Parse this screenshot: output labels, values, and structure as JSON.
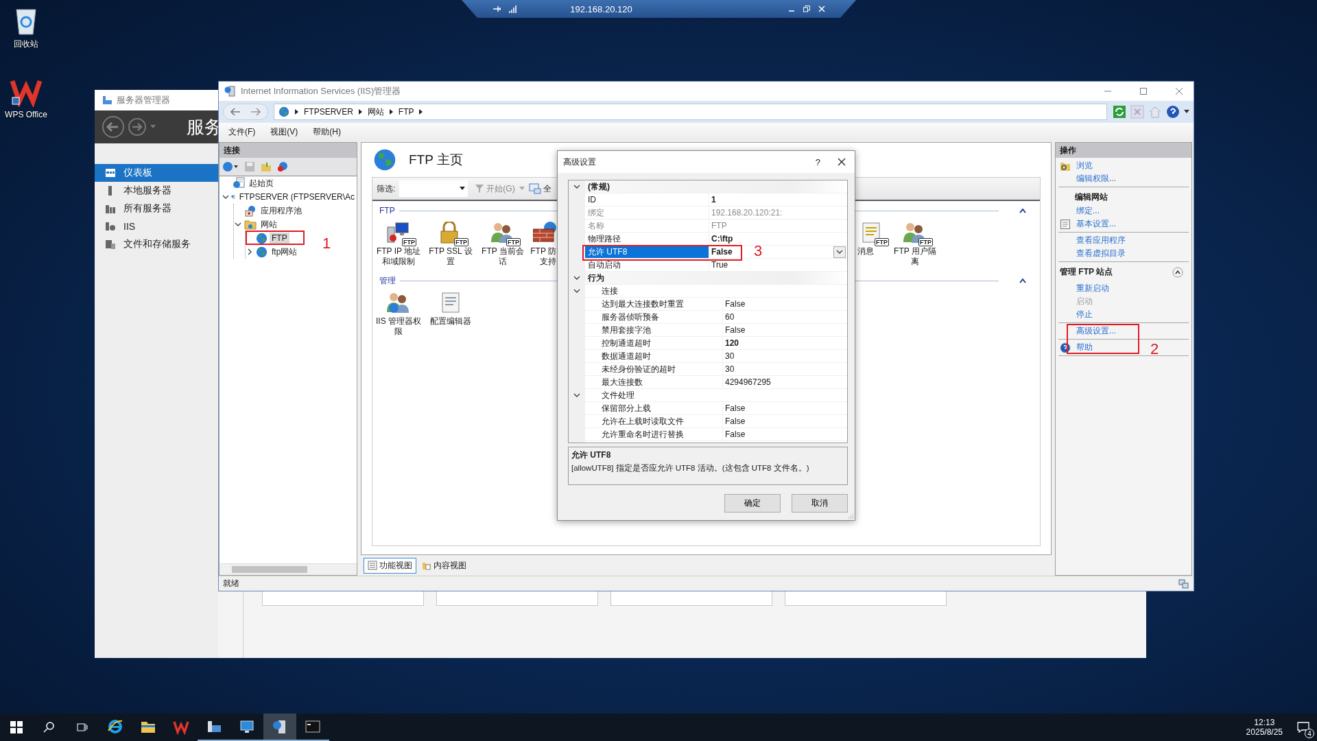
{
  "remote_bar": {
    "address": "192.168.20.120"
  },
  "desktop_icons": [
    {
      "label": "回收站",
      "kind": "recycle"
    },
    {
      "label": "WPS Office",
      "kind": "wps"
    }
  ],
  "server_manager": {
    "title": "服务器管理器",
    "header": "服务",
    "nav": [
      {
        "label": "仪表板",
        "kind": "dashboard",
        "selected": true
      },
      {
        "label": "本地服务器",
        "kind": "server",
        "selected": false
      },
      {
        "label": "所有服务器",
        "kind": "servers",
        "selected": false
      },
      {
        "label": "IIS",
        "kind": "iis",
        "selected": false
      },
      {
        "label": "文件和存储服务",
        "kind": "files",
        "selected": false
      }
    ]
  },
  "iis": {
    "title": "Internet Information Services (IIS)管理器",
    "breadcrumb": [
      "FTPSERVER",
      "网站",
      "FTP"
    ],
    "menu": [
      "文件(F)",
      "视图(V)",
      "帮助(H)"
    ],
    "connections": {
      "title": "连接",
      "tree": [
        {
          "label": "起始页",
          "kind": "start",
          "selected": false
        },
        {
          "label": "FTPSERVER (FTPSERVER\\Ac",
          "kind": "server",
          "selected": false,
          "expanded": true,
          "children": [
            {
              "label": "应用程序池",
              "kind": "pool",
              "selected": false
            },
            {
              "label": "网站",
              "kind": "folder",
              "selected": false,
              "expanded": true,
              "children": [
                {
                  "label": "FTP",
                  "kind": "site",
                  "selected": true
                },
                {
                  "label": "ftp网站",
                  "kind": "site",
                  "selected": false,
                  "expanded": false
                }
              ]
            }
          ]
        }
      ]
    },
    "home": {
      "title": "FTP 主页",
      "filter_label": "筛选:",
      "go_label": "开始(G)",
      "show_all_label": "全",
      "groups": [
        {
          "label": "FTP",
          "expanded": true,
          "features": [
            {
              "label": "FTP IP 地址和域限制",
              "kind": "ip",
              "badge": "FTP"
            },
            {
              "label": "FTP SSL 设置",
              "kind": "ssl",
              "badge": "FTP"
            },
            {
              "label": "FTP 当前会话",
              "kind": "sessions",
              "badge": "FTP"
            },
            {
              "label": "FTP 防",
              "label_cont": "支持",
              "kind": "firewall"
            },
            {
              "label": "消息",
              "kind": "messages",
              "badge": "FTP"
            },
            {
              "label": "FTP 用户隔离",
              "kind": "isolation",
              "badge": "FTP"
            }
          ]
        },
        {
          "label": "管理",
          "expanded": true,
          "features": [
            {
              "label": "IIS 管理器权限",
              "kind": "permissions"
            },
            {
              "label": "配置编辑器",
              "kind": "config"
            }
          ]
        }
      ]
    },
    "view_tabs": [
      {
        "label": "功能视图",
        "kind": "features",
        "selected": true
      },
      {
        "label": "内容视图",
        "kind": "content",
        "selected": false
      }
    ],
    "actions": {
      "title": "操作",
      "groups": [
        {
          "items": [
            {
              "label": "浏览",
              "kind": "browse",
              "disabled": false
            },
            {
              "label": "编辑权限...",
              "kind": "link",
              "disabled": false
            }
          ]
        },
        {
          "title": "编辑网站",
          "items": [
            {
              "label": "绑定...",
              "kind": "link",
              "disabled": false
            },
            {
              "label": "基本设置...",
              "kind": "settings",
              "disabled": false
            }
          ]
        },
        {
          "items": [
            {
              "label": "查看应用程序",
              "kind": "link",
              "disabled": false
            },
            {
              "label": "查看虚拟目录",
              "kind": "link",
              "disabled": false
            }
          ]
        }
      ],
      "sections": [
        {
          "title": "管理 FTP 站点",
          "expanded": true,
          "groups": [
            {
              "items": [
                {
                  "label": "重新启动",
                  "kind": "link",
                  "disabled": false
                },
                {
                  "label": "启动",
                  "kind": "link",
                  "disabled": true
                },
                {
                  "label": "停止",
                  "kind": "link",
                  "disabled": false
                }
              ]
            },
            {
              "items": [
                {
                  "label": "高级设置...",
                  "kind": "link",
                  "disabled": false
                }
              ]
            },
            {
              "items": [
                {
                  "label": "帮助",
                  "kind": "help",
                  "disabled": false
                }
              ]
            }
          ]
        }
      ]
    },
    "status": "就绪"
  },
  "dialog": {
    "title": "高级设置",
    "help_label": "?",
    "properties": [
      {
        "label": "(常规)",
        "kind": "category",
        "expanded": true,
        "children": [
          {
            "label": "ID",
            "value": "1",
            "modified": true,
            "disabled": false,
            "selected": false
          },
          {
            "label": "绑定",
            "value": "192.168.20.120:21:",
            "modified": false,
            "disabled": true,
            "selected": false
          },
          {
            "label": "名称",
            "value": "FTP",
            "modified": false,
            "disabled": true,
            "selected": false
          },
          {
            "label": "物理路径",
            "value": "C:\\ftp",
            "modified": true,
            "disabled": false,
            "selected": false
          },
          {
            "label": "允许 UTF8",
            "value": "False",
            "modified": true,
            "disabled": false,
            "selected": true
          },
          {
            "label": "自动启动",
            "value": "True",
            "modified": false,
            "disabled": false,
            "selected": false
          }
        ]
      },
      {
        "label": "行为",
        "kind": "category",
        "expanded": true,
        "children": [
          {
            "label": "连接",
            "kind": "subcategory",
            "expanded": true,
            "children": [
              {
                "label": "达到最大连接数时重置",
                "value": "False",
                "modified": false,
                "disabled": false,
                "selected": false
              },
              {
                "label": "服务器侦听预备",
                "value": "60",
                "modified": false,
                "disabled": false,
                "selected": false
              },
              {
                "label": "禁用套接字池",
                "value": "False",
                "modified": false,
                "disabled": false,
                "selected": false
              },
              {
                "label": "控制通道超时",
                "value": "120",
                "modified": true,
                "disabled": false,
                "selected": false
              },
              {
                "label": "数据通道超时",
                "value": "30",
                "modified": false,
                "disabled": false,
                "selected": false
              },
              {
                "label": "未经身份验证的超时",
                "value": "30",
                "modified": false,
                "disabled": false,
                "selected": false
              },
              {
                "label": "最大连接数",
                "value": "4294967295",
                "modified": false,
                "disabled": false,
                "selected": false
              }
            ]
          },
          {
            "label": "文件处理",
            "kind": "subcategory",
            "expanded": true,
            "children": [
              {
                "label": "保留部分上载",
                "value": "False",
                "modified": false,
                "disabled": false,
                "selected": false
              },
              {
                "label": "允许在上载时读取文件",
                "value": "False",
                "modified": false,
                "disabled": false,
                "selected": false
              },
              {
                "label": "允许重命名时进行替换",
                "value": "False",
                "modified": false,
                "disabled": false,
                "selected": false
              }
            ]
          }
        ]
      }
    ],
    "description": {
      "title": "允许 UTF8",
      "text": "[allowUTF8] 指定是否应允许 UTF8 活动。(这包含 UTF8 文件名。)"
    },
    "buttons": [
      "确定",
      "取消"
    ]
  },
  "annotations": [
    {
      "label": "1"
    },
    {
      "label": "2"
    },
    {
      "label": "3"
    }
  ],
  "taskbar": {
    "apps": [
      {
        "kind": "ie",
        "open": false,
        "active": false
      },
      {
        "kind": "explorer",
        "open": false,
        "active": false
      },
      {
        "kind": "wps",
        "open": false,
        "active": false
      },
      {
        "kind": "server-manager",
        "open": true,
        "active": false
      },
      {
        "kind": "remote",
        "open": true,
        "active": false
      },
      {
        "kind": "iis",
        "open": true,
        "active": true
      },
      {
        "kind": "cmd",
        "open": true,
        "active": false
      }
    ],
    "time": "12:13",
    "date": "2025/8/25",
    "notifications": "4"
  }
}
